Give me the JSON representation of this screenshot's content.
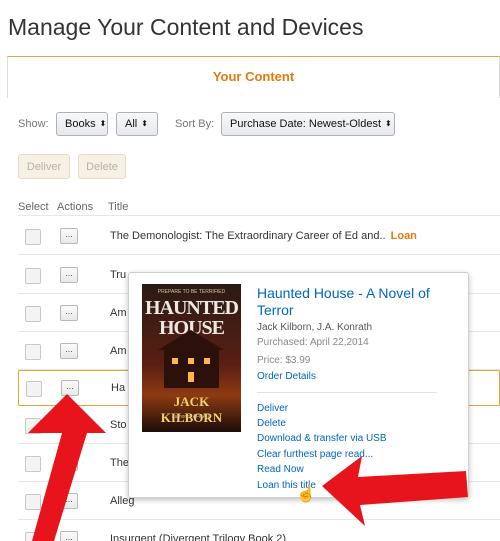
{
  "page": {
    "title": "Manage Your Content and Devices"
  },
  "tab": {
    "label": "Your Content"
  },
  "filters": {
    "show_label": "Show:",
    "show_value": "Books",
    "scope_value": "All",
    "sort_label": "Sort By:",
    "sort_value": "Purchase Date: Newest-Oldest"
  },
  "bulk_actions": {
    "deliver": "Deliver",
    "delete": "Delete"
  },
  "columns": {
    "select": "Select",
    "actions": "Actions",
    "title": "Title"
  },
  "action_button_label": "...",
  "rows": [
    {
      "title": "The Demonologist: The Extraordinary Career of Ed and..",
      "badge": "Loan"
    },
    {
      "title": "Tru",
      "badge": ""
    },
    {
      "title": "Am",
      "badge": ""
    },
    {
      "title": "Am",
      "badge": ""
    },
    {
      "title": "Ha",
      "badge": ""
    },
    {
      "title": "Sto",
      "badge": ""
    },
    {
      "title": "The",
      "badge": ""
    },
    {
      "title": "Alleg",
      "badge": ""
    },
    {
      "title": "Insurgent (Divergent Trilogy Book 2)",
      "badge": ""
    }
  ],
  "popup": {
    "title": "Haunted House - A Novel of Terror",
    "authors": "Jack Kilborn, J.A. Konrath",
    "purchased": "Purchased: April 22,2014",
    "price": "Price: $3.99",
    "order_details": "Order Details",
    "actions": [
      "Deliver",
      "Delete",
      "Download & transfer via USB",
      "Clear furthest page read...",
      "Read Now",
      "Loan this title"
    ],
    "cover": {
      "top_text": "PREPARE TO BE TERRIFIED",
      "title_line1": "HAUNTED",
      "title_line2": "HOUSE",
      "author": "JACK KILBORN",
      "subtitle": "author of AFRAID"
    }
  },
  "colors": {
    "accent": "#e47911",
    "link": "#0066c0",
    "annotation_arrow": "#e8141b"
  }
}
